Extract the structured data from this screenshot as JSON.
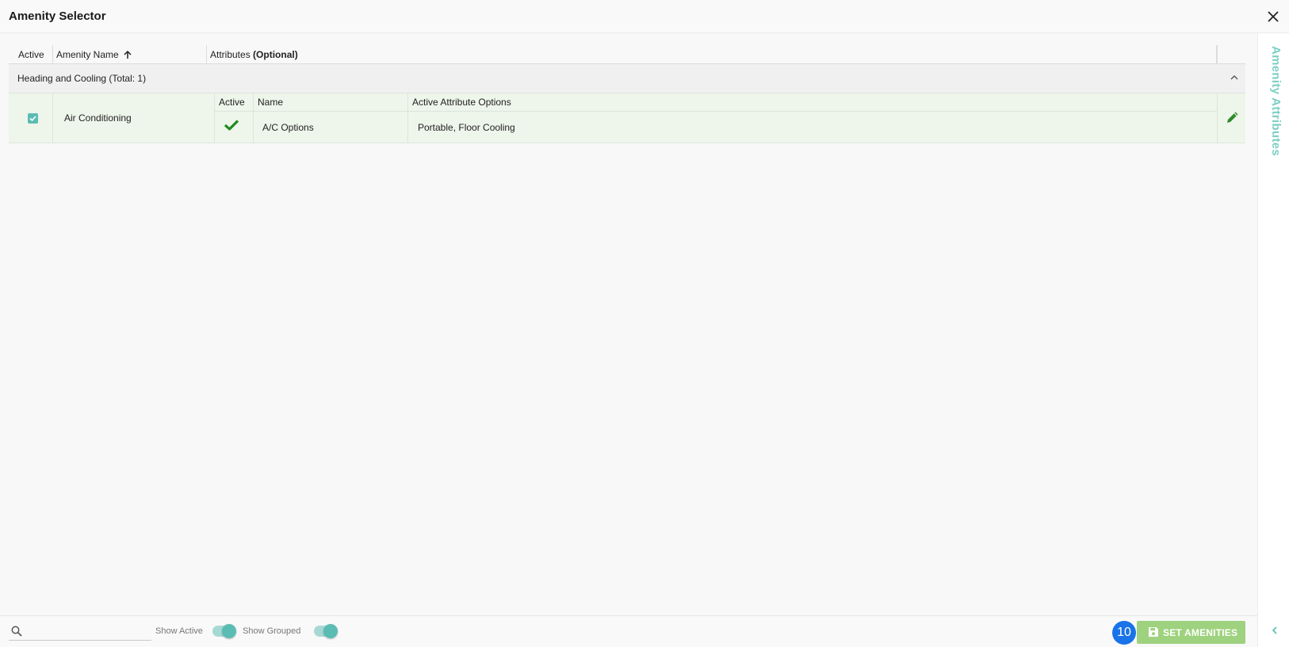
{
  "window": {
    "title": "Amenity Selector",
    "close_icon": "close-icon"
  },
  "grid": {
    "headers": {
      "active": "Active",
      "amenity_name": "Amenity Name",
      "attributes": "Attributes",
      "attributes_suffix": "(Optional)"
    },
    "groups": [
      {
        "label": "Heading and Cooling (Total: 1)",
        "rows": [
          {
            "active": true,
            "amenity_name": "Air Conditioning",
            "attributes": {
              "headers": {
                "active": "Active",
                "name": "Name",
                "options": "Active Attribute Options"
              },
              "rows": [
                {
                  "active": true,
                  "name": "A/C Options",
                  "options": "Portable, Floor Cooling"
                }
              ]
            }
          }
        ]
      }
    ]
  },
  "side_panel": {
    "label": "Amenity Attributes"
  },
  "footer": {
    "search": {
      "placeholder": "",
      "value": ""
    },
    "show_active": {
      "label": "Show Active",
      "on": true
    },
    "show_grouped": {
      "label": "Show Grouped",
      "on": true
    },
    "badge_count": "10",
    "set_button": "SET AMENITIES"
  },
  "colors": {
    "accent": "#5bbcb3",
    "row_highlight": "#eef5ea",
    "check_green": "#1e8a1e",
    "button_green": "#9ed27e",
    "badge_blue": "#1a73e8"
  }
}
